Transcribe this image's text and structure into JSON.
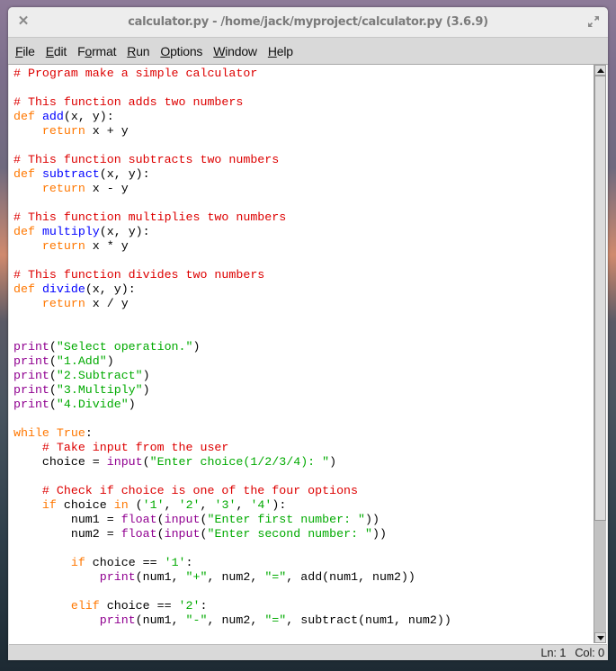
{
  "window": {
    "title": "calculator.py - /home/jack/myproject/calculator.py (3.6.9)",
    "close_icon": "close-icon",
    "maximize_icon": "maximize-icon"
  },
  "menubar": {
    "items": [
      {
        "label": "File",
        "mnemonic_index": 0
      },
      {
        "label": "Edit",
        "mnemonic_index": 0
      },
      {
        "label": "Format",
        "mnemonic_index": 1
      },
      {
        "label": "Run",
        "mnemonic_index": 0
      },
      {
        "label": "Options",
        "mnemonic_index": 0
      },
      {
        "label": "Window",
        "mnemonic_index": 0
      },
      {
        "label": "Help",
        "mnemonic_index": 0
      }
    ]
  },
  "editor": {
    "syntax_colors": {
      "comment": "#dd0000",
      "keyword": "#ff7700",
      "definition": "#0000ff",
      "builtin": "#900090",
      "string": "#00aa00",
      "plain": "#000000"
    },
    "lines": [
      [
        [
          "comment",
          "# Program make a simple calculator"
        ]
      ],
      [],
      [
        [
          "comment",
          "# This function adds two numbers"
        ]
      ],
      [
        [
          "keyword",
          "def"
        ],
        [
          "plain",
          " "
        ],
        [
          "def",
          "add"
        ],
        [
          "plain",
          "(x, y):"
        ]
      ],
      [
        [
          "plain",
          "    "
        ],
        [
          "keyword",
          "return"
        ],
        [
          "plain",
          " x + y"
        ]
      ],
      [],
      [
        [
          "comment",
          "# This function subtracts two numbers"
        ]
      ],
      [
        [
          "keyword",
          "def"
        ],
        [
          "plain",
          " "
        ],
        [
          "def",
          "subtract"
        ],
        [
          "plain",
          "(x, y):"
        ]
      ],
      [
        [
          "plain",
          "    "
        ],
        [
          "keyword",
          "return"
        ],
        [
          "plain",
          " x - y"
        ]
      ],
      [],
      [
        [
          "comment",
          "# This function multiplies two numbers"
        ]
      ],
      [
        [
          "keyword",
          "def"
        ],
        [
          "plain",
          " "
        ],
        [
          "def",
          "multiply"
        ],
        [
          "plain",
          "(x, y):"
        ]
      ],
      [
        [
          "plain",
          "    "
        ],
        [
          "keyword",
          "return"
        ],
        [
          "plain",
          " x * y"
        ]
      ],
      [],
      [
        [
          "comment",
          "# This function divides two numbers"
        ]
      ],
      [
        [
          "keyword",
          "def"
        ],
        [
          "plain",
          " "
        ],
        [
          "def",
          "divide"
        ],
        [
          "plain",
          "(x, y):"
        ]
      ],
      [
        [
          "plain",
          "    "
        ],
        [
          "keyword",
          "return"
        ],
        [
          "plain",
          " x / y"
        ]
      ],
      [],
      [],
      [
        [
          "builtin",
          "print"
        ],
        [
          "plain",
          "("
        ],
        [
          "string",
          "\"Select operation.\""
        ],
        [
          "plain",
          ")"
        ]
      ],
      [
        [
          "builtin",
          "print"
        ],
        [
          "plain",
          "("
        ],
        [
          "string",
          "\"1.Add\""
        ],
        [
          "plain",
          ")"
        ]
      ],
      [
        [
          "builtin",
          "print"
        ],
        [
          "plain",
          "("
        ],
        [
          "string",
          "\"2.Subtract\""
        ],
        [
          "plain",
          ")"
        ]
      ],
      [
        [
          "builtin",
          "print"
        ],
        [
          "plain",
          "("
        ],
        [
          "string",
          "\"3.Multiply\""
        ],
        [
          "plain",
          ")"
        ]
      ],
      [
        [
          "builtin",
          "print"
        ],
        [
          "plain",
          "("
        ],
        [
          "string",
          "\"4.Divide\""
        ],
        [
          "plain",
          ")"
        ]
      ],
      [],
      [
        [
          "keyword",
          "while"
        ],
        [
          "plain",
          " "
        ],
        [
          "keyword",
          "True"
        ],
        [
          "plain",
          ":"
        ]
      ],
      [
        [
          "plain",
          "    "
        ],
        [
          "comment",
          "# Take input from the user"
        ]
      ],
      [
        [
          "plain",
          "    choice = "
        ],
        [
          "builtin",
          "input"
        ],
        [
          "plain",
          "("
        ],
        [
          "string",
          "\"Enter choice(1/2/3/4): \""
        ],
        [
          "plain",
          ")"
        ]
      ],
      [],
      [
        [
          "plain",
          "    "
        ],
        [
          "comment",
          "# Check if choice is one of the four options"
        ]
      ],
      [
        [
          "plain",
          "    "
        ],
        [
          "keyword",
          "if"
        ],
        [
          "plain",
          " choice "
        ],
        [
          "keyword",
          "in"
        ],
        [
          "plain",
          " ("
        ],
        [
          "string",
          "'1'"
        ],
        [
          "plain",
          ", "
        ],
        [
          "string",
          "'2'"
        ],
        [
          "plain",
          ", "
        ],
        [
          "string",
          "'3'"
        ],
        [
          "plain",
          ", "
        ],
        [
          "string",
          "'4'"
        ],
        [
          "plain",
          "):"
        ]
      ],
      [
        [
          "plain",
          "        num1 = "
        ],
        [
          "builtin",
          "float"
        ],
        [
          "plain",
          "("
        ],
        [
          "builtin",
          "input"
        ],
        [
          "plain",
          "("
        ],
        [
          "string",
          "\"Enter first number: \""
        ],
        [
          "plain",
          "))"
        ]
      ],
      [
        [
          "plain",
          "        num2 = "
        ],
        [
          "builtin",
          "float"
        ],
        [
          "plain",
          "("
        ],
        [
          "builtin",
          "input"
        ],
        [
          "plain",
          "("
        ],
        [
          "string",
          "\"Enter second number: \""
        ],
        [
          "plain",
          "))"
        ]
      ],
      [],
      [
        [
          "plain",
          "        "
        ],
        [
          "keyword",
          "if"
        ],
        [
          "plain",
          " choice == "
        ],
        [
          "string",
          "'1'"
        ],
        [
          "plain",
          ":"
        ]
      ],
      [
        [
          "plain",
          "            "
        ],
        [
          "builtin",
          "print"
        ],
        [
          "plain",
          "(num1, "
        ],
        [
          "string",
          "\"+\""
        ],
        [
          "plain",
          ", num2, "
        ],
        [
          "string",
          "\"=\""
        ],
        [
          "plain",
          ", add(num1, num2))"
        ]
      ],
      [],
      [
        [
          "plain",
          "        "
        ],
        [
          "keyword",
          "elif"
        ],
        [
          "plain",
          " choice == "
        ],
        [
          "string",
          "'2'"
        ],
        [
          "plain",
          ":"
        ]
      ],
      [
        [
          "plain",
          "            "
        ],
        [
          "builtin",
          "print"
        ],
        [
          "plain",
          "(num1, "
        ],
        [
          "string",
          "\"-\""
        ],
        [
          "plain",
          ", num2, "
        ],
        [
          "string",
          "\"=\""
        ],
        [
          "plain",
          ", subtract(num1, num2))"
        ]
      ]
    ]
  },
  "scrollbar": {
    "position_fraction": 0.0,
    "visible_fraction": 0.8,
    "up_icon": "scroll-up-arrow-icon",
    "down_icon": "scroll-down-arrow-icon"
  },
  "statusbar": {
    "line": "Ln: 1",
    "col": "Col: 0"
  }
}
